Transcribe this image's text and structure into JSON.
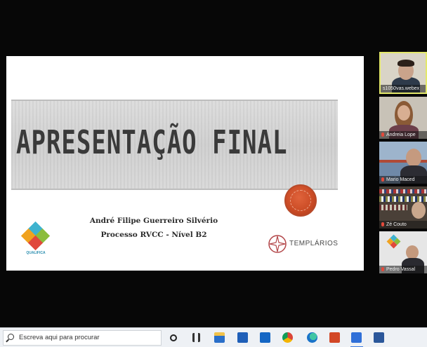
{
  "slide": {
    "title": "APRESENTAÇÃO FINAL",
    "author": "André Filipe Guerreiro Silvério",
    "process": "Processo RVCC - Nível B2",
    "left_logo_text": "QUALIFICA",
    "right_logo_text": "TEMPLÁRIOS",
    "accent_red": "#c94a24"
  },
  "participants": [
    {
      "name": "s1050vas.webex",
      "active": true
    },
    {
      "name": "Andreia Lope",
      "active": false
    },
    {
      "name": "Mario Maced",
      "active": false
    },
    {
      "name": "Zé Couto",
      "active": false
    },
    {
      "name": "Pedro Vassal",
      "active": false
    }
  ],
  "taskbar": {
    "search_placeholder": "Escreva aqui para procurar",
    "icons": [
      "start-circle-icon",
      "task-view-icon",
      "file-explorer-icon",
      "store-icon",
      "mail-icon",
      "chrome-icon",
      "edge-icon",
      "powerpoint-icon",
      "webex-icon",
      "word-icon"
    ]
  }
}
